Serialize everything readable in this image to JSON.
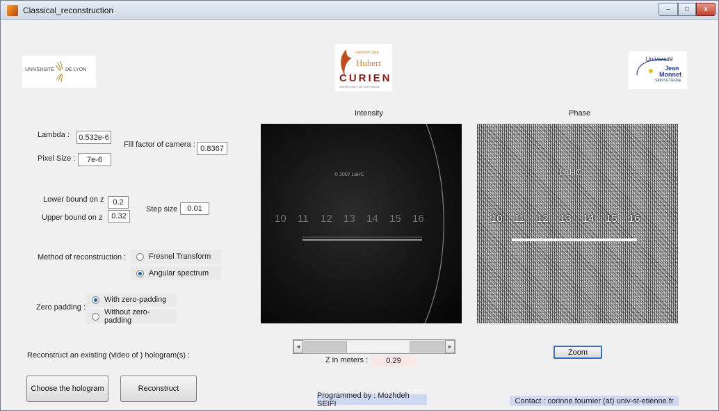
{
  "window": {
    "title": "Classical_reconstruction",
    "min_symbol": "–",
    "max_symbol": "□",
    "close_symbol": "x"
  },
  "logos": {
    "lyon": {
      "text_left": "UNIVERSITÉ",
      "text_right": "DE LYON"
    },
    "curien": {
      "line1": "LABORATOIRE",
      "line2": "Hubert",
      "line3": "CURIEN",
      "line4": "UMR 5516 CNRS • UNIV. SAINT ETIENNE"
    },
    "saint_etienne": {
      "line1": "Université",
      "line2": "Jean",
      "line3": "Monnet",
      "line4": "SAINT-ETIENNE"
    }
  },
  "params": {
    "lambda": {
      "label": "Lambda :",
      "value": "0.532e-6"
    },
    "pixel_size": {
      "label": "Pixel Size :",
      "value": "7e-6"
    },
    "fill_factor": {
      "label": "Fill factor of camera :",
      "value": "0.8367"
    },
    "lower_z": {
      "label": "Lower bound on z",
      "value": "0.2"
    },
    "upper_z": {
      "label": "Upper bound on z",
      "value": "0.32"
    },
    "step": {
      "label": "Step size :",
      "value": "0.01"
    }
  },
  "method": {
    "label": "Method of reconstruction :",
    "options": [
      {
        "label": "Fresnel Transform",
        "selected": false
      },
      {
        "label": "Angular spectrum",
        "selected": true
      }
    ]
  },
  "padding": {
    "label": "Zero padding :",
    "options": [
      {
        "label": "With zero-padding",
        "selected": true
      },
      {
        "label": "Without zero-padding",
        "selected": false
      }
    ]
  },
  "reconstruct_text": "Reconstruct an existing (video of ) hologram(s) :",
  "buttons": {
    "choose": "Choose the hologram",
    "reconstruct": "Reconstruct",
    "zoom": "Zoom"
  },
  "panels": {
    "intensity_title": "Intensity",
    "phase_title": "Phase",
    "ruler_numbers": [
      "10",
      "11",
      "12",
      "13",
      "14",
      "15",
      "16"
    ],
    "copyright": "© 2007 LaHC",
    "phase_overlay": "LaHC",
    "phase_ruler_numbers": [
      "10",
      "11",
      "12",
      "13",
      "14",
      "15",
      "16"
    ]
  },
  "slider": {
    "left_arrow": "◂",
    "right_arrow": "▸",
    "position": 0.55
  },
  "z": {
    "label": "Z in meters :",
    "value": "0.29"
  },
  "footer": {
    "programmed_by": "Programmed by : Mozhdeh SEIFI",
    "contact": "Contact : corinne.fournier (at) univ-st-etienne.fr"
  }
}
